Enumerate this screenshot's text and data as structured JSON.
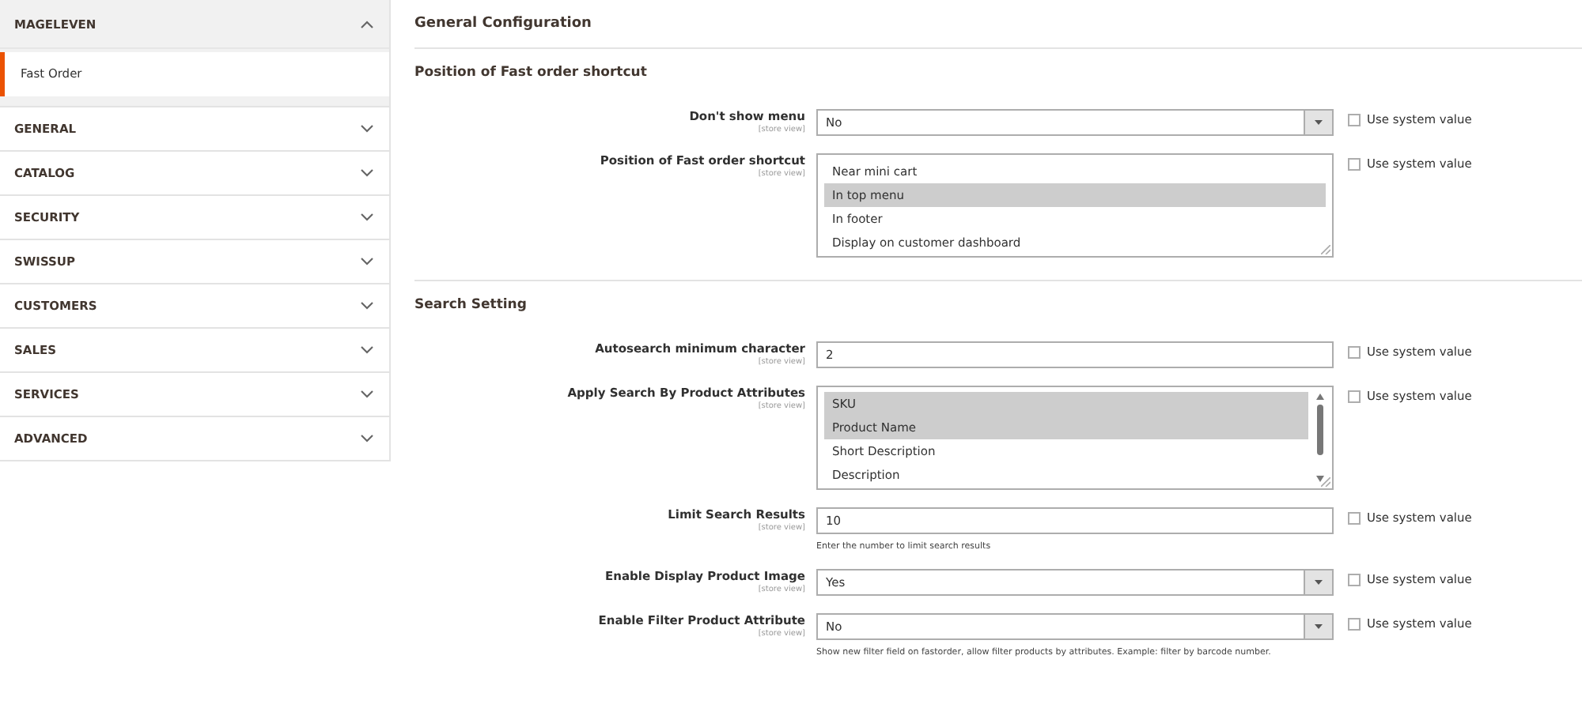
{
  "sidebar": {
    "sections": [
      {
        "title": "MAGELEVEN",
        "expanded": true,
        "items": [
          {
            "label": "Fast Order",
            "selected": true
          }
        ]
      },
      {
        "title": "GENERAL",
        "expanded": false
      },
      {
        "title": "CATALOG",
        "expanded": false
      },
      {
        "title": "SECURITY",
        "expanded": false
      },
      {
        "title": "SWISSUP",
        "expanded": false
      },
      {
        "title": "CUSTOMERS",
        "expanded": false
      },
      {
        "title": "SALES",
        "expanded": false
      },
      {
        "title": "SERVICES",
        "expanded": false
      },
      {
        "title": "ADVANCED",
        "expanded": false
      }
    ]
  },
  "main": {
    "title": "General Configuration",
    "groups": [
      {
        "title": "Position of Fast order shortcut",
        "fields": [
          {
            "kind": "select",
            "label": "Don't show menu",
            "scope": "[store view]",
            "value": "No",
            "use_system_value": {
              "label": "Use system value",
              "checked": false
            }
          },
          {
            "kind": "multiselect",
            "label": "Position of Fast order shortcut",
            "scope": "[store view]",
            "options": [
              {
                "label": "Near mini cart",
                "selected": false
              },
              {
                "label": "In top menu",
                "selected": true
              },
              {
                "label": "In footer",
                "selected": false
              },
              {
                "label": "Display on customer dashboard",
                "selected": false
              }
            ],
            "use_system_value": {
              "label": "Use system value",
              "checked": false
            }
          }
        ]
      },
      {
        "title": "Search Setting",
        "fields": [
          {
            "kind": "text",
            "label": "Autosearch minimum character",
            "scope": "[store view]",
            "value": "2",
            "use_system_value": {
              "label": "Use system value",
              "checked": false
            }
          },
          {
            "kind": "scroll-multiselect",
            "label": "Apply Search By Product Attributes",
            "scope": "[store view]",
            "options": [
              {
                "label": "SKU",
                "selected": true
              },
              {
                "label": "Product Name",
                "selected": true
              },
              {
                "label": "Short Description",
                "selected": false
              },
              {
                "label": "Description",
                "selected": false
              }
            ],
            "use_system_value": {
              "label": "Use system value",
              "checked": false
            }
          },
          {
            "kind": "text",
            "label": "Limit Search Results",
            "scope": "[store view]",
            "value": "10",
            "note": "Enter the number to limit search results",
            "use_system_value": {
              "label": "Use system value",
              "checked": false
            }
          },
          {
            "kind": "select",
            "label": "Enable Display Product Image",
            "scope": "[store view]",
            "value": "Yes",
            "use_system_value": {
              "label": "Use system value",
              "checked": false
            }
          },
          {
            "kind": "select",
            "label": "Enable Filter Product Attribute",
            "scope": "[store view]",
            "value": "No",
            "note": "Show new filter field on fastorder, allow filter products by attributes. Example: filter by barcode number.",
            "use_system_value": {
              "label": "Use system value",
              "checked": false
            }
          }
        ]
      }
    ]
  }
}
